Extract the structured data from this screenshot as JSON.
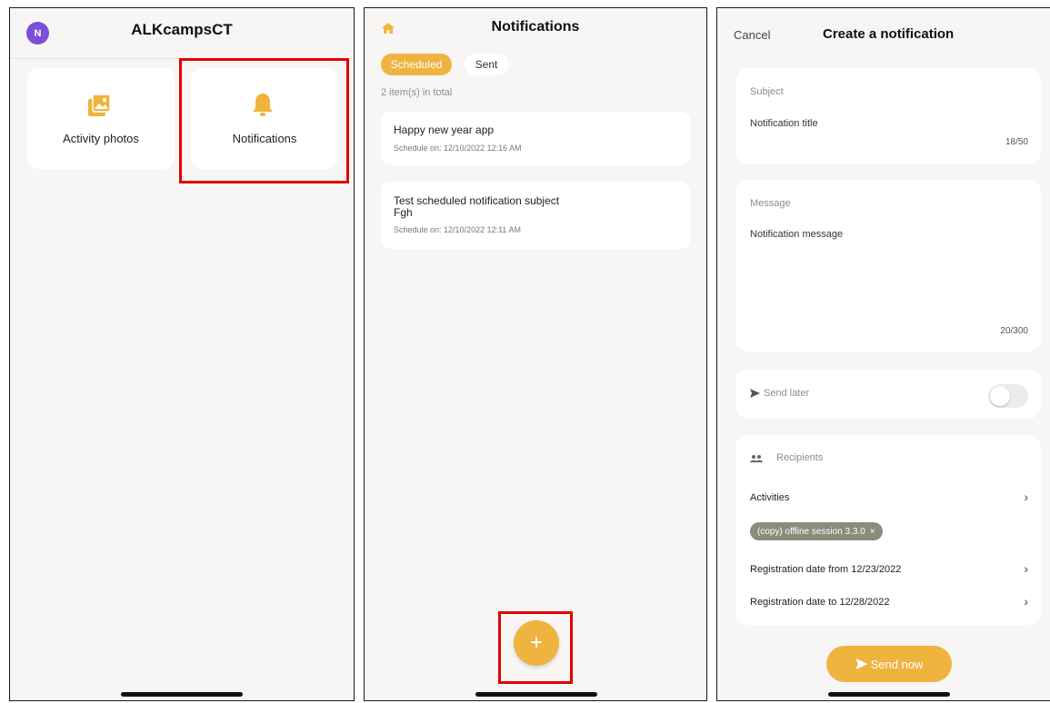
{
  "home": {
    "avatar_initial": "N",
    "title": "ALKcampsCT",
    "tiles": [
      {
        "label": "Activity photos",
        "icon": "photo-gallery-icon"
      },
      {
        "label": "Notifications",
        "icon": "bell-icon"
      }
    ]
  },
  "notifications": {
    "title": "Notifications",
    "home_icon": "home-icon",
    "tabs": {
      "scheduled": "Scheduled",
      "sent": "Sent"
    },
    "total": "2 item(s) in total",
    "items": [
      {
        "title": "Happy new year app",
        "schedule": "Schedule on: 12/10/2022 12:16 AM"
      },
      {
        "title": "Test scheduled notification subject",
        "title2": "Fgh",
        "schedule": "Schedule on: 12/10/2022 12:11 AM"
      }
    ],
    "fab": "+"
  },
  "create": {
    "cancel": "Cancel",
    "title": "Create a notification",
    "subject_label": "Subject",
    "subject_value": "Notification title",
    "subject_count": "18/50",
    "message_label": "Message",
    "message_value": "Notification message",
    "message_count": "20/300",
    "send_later": "Send later",
    "send_later_on": false,
    "recipients_label": "Recipients",
    "activities": "Activities",
    "chip": "(copy) offline session 3.3.0",
    "chip_close": "×",
    "reg_from": "Registration date from 12/23/2022",
    "reg_to": "Registration date to 12/28/2022",
    "send_now": "Send now"
  },
  "colors": {
    "accent": "#efb340",
    "highlight": "#e00000",
    "avatar": "#7b4fd6",
    "chip": "#8a8d7a"
  }
}
